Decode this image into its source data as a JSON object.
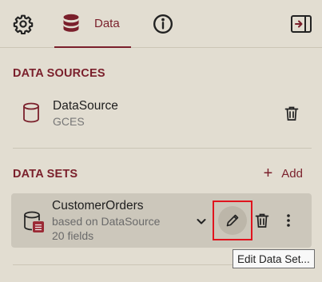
{
  "tabs": [
    {
      "name": "settings",
      "icon": "gear-icon",
      "label": ""
    },
    {
      "name": "data",
      "icon": "database-icon",
      "label": "Data",
      "active": true
    },
    {
      "name": "info",
      "icon": "info-icon",
      "label": ""
    }
  ],
  "collapse_icon": "panel-collapse-icon",
  "data_sources": {
    "title": "DATA SOURCES",
    "items": [
      {
        "name": "DataSource",
        "subtitle": "GCES"
      }
    ]
  },
  "data_sets": {
    "title": "DATA SETS",
    "add_label": "Add",
    "items": [
      {
        "name": "CustomerOrders",
        "based_on": "based on DataSource",
        "fields": "20 fields"
      }
    ]
  },
  "tooltip": "Edit Data Set...",
  "colors": {
    "accent": "#7a1f2b",
    "background": "#e2ddd1",
    "card": "#ccc7bb",
    "highlight": "#e0141e"
  }
}
